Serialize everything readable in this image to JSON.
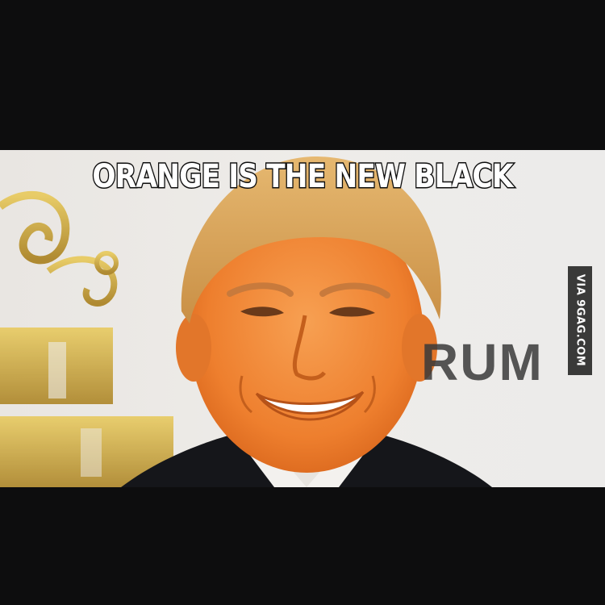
{
  "meme": {
    "caption": "ORANGE IS THE NEW BLACK",
    "watermark": "VIA 9GAG.COM",
    "backdrop_text": "RUM"
  },
  "colors": {
    "letterbox": "#0d0d0e",
    "skin": "#f08a3c",
    "hair": "#d9a25c",
    "gold_logo": "#c9a235"
  }
}
